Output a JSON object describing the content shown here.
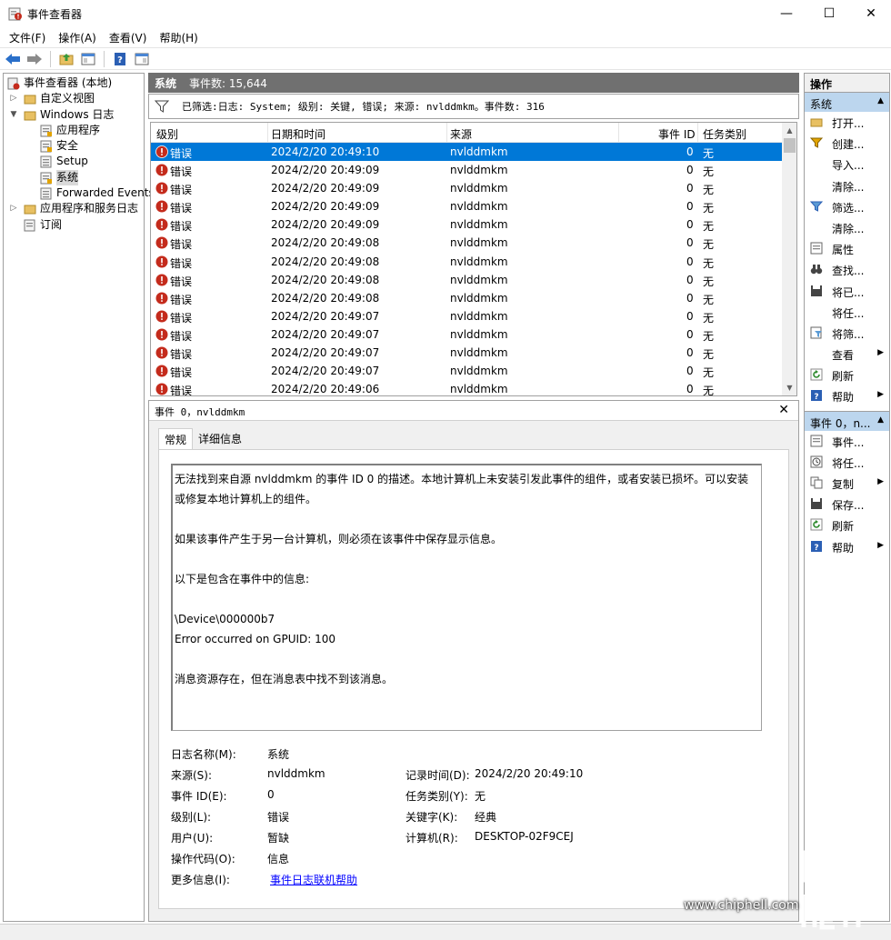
{
  "window": {
    "title": "事件查看器",
    "min": "—",
    "max": "☐",
    "close": "✕"
  },
  "menu": [
    "文件(F)",
    "操作(A)",
    "查看(V)",
    "帮助(H)"
  ],
  "tree": {
    "root": "事件查看器 (本地)",
    "custom_views": "自定义视图",
    "windows_logs": "Windows 日志",
    "app": "应用程序",
    "security": "安全",
    "setup": "Setup",
    "system": "系统",
    "forwarded": "Forwarded Events",
    "app_services": "应用程序和服务日志",
    "subscriptions": "订阅"
  },
  "middle": {
    "log_name": "系统",
    "event_count": "事件数: 15,644",
    "filter_text": "已筛选:日志: System; 级别: 关键, 错误; 来源: nvlddmkm。事件数: 316"
  },
  "grid": {
    "headers": {
      "level": "级别",
      "datetime": "日期和时间",
      "source": "来源",
      "event_id": "事件 ID",
      "task": "任务类别"
    },
    "rows": [
      {
        "level": "错误",
        "datetime": "2024/2/20 20:49:10",
        "source": "nvlddmkm",
        "event_id": "0",
        "task": "无"
      },
      {
        "level": "错误",
        "datetime": "2024/2/20 20:49:09",
        "source": "nvlddmkm",
        "event_id": "0",
        "task": "无"
      },
      {
        "level": "错误",
        "datetime": "2024/2/20 20:49:09",
        "source": "nvlddmkm",
        "event_id": "0",
        "task": "无"
      },
      {
        "level": "错误",
        "datetime": "2024/2/20 20:49:09",
        "source": "nvlddmkm",
        "event_id": "0",
        "task": "无"
      },
      {
        "level": "错误",
        "datetime": "2024/2/20 20:49:09",
        "source": "nvlddmkm",
        "event_id": "0",
        "task": "无"
      },
      {
        "level": "错误",
        "datetime": "2024/2/20 20:49:08",
        "source": "nvlddmkm",
        "event_id": "0",
        "task": "无"
      },
      {
        "level": "错误",
        "datetime": "2024/2/20 20:49:08",
        "source": "nvlddmkm",
        "event_id": "0",
        "task": "无"
      },
      {
        "level": "错误",
        "datetime": "2024/2/20 20:49:08",
        "source": "nvlddmkm",
        "event_id": "0",
        "task": "无"
      },
      {
        "level": "错误",
        "datetime": "2024/2/20 20:49:08",
        "source": "nvlddmkm",
        "event_id": "0",
        "task": "无"
      },
      {
        "level": "错误",
        "datetime": "2024/2/20 20:49:07",
        "source": "nvlddmkm",
        "event_id": "0",
        "task": "无"
      },
      {
        "level": "错误",
        "datetime": "2024/2/20 20:49:07",
        "source": "nvlddmkm",
        "event_id": "0",
        "task": "无"
      },
      {
        "level": "错误",
        "datetime": "2024/2/20 20:49:07",
        "source": "nvlddmkm",
        "event_id": "0",
        "task": "无"
      },
      {
        "level": "错误",
        "datetime": "2024/2/20 20:49:07",
        "source": "nvlddmkm",
        "event_id": "0",
        "task": "无"
      },
      {
        "level": "错误",
        "datetime": "2024/2/20 20:49:06",
        "source": "nvlddmkm",
        "event_id": "0",
        "task": "无"
      }
    ]
  },
  "detail": {
    "title": "事件 0，nvlddmkm",
    "tabs": [
      "常规",
      "详细信息"
    ],
    "description": "无法找到来自源 nvlddmkm 的事件 ID 0 的描述。本地计算机上未安装引发此事件的组件，或者安装已损坏。可以安装或修复本地计算机上的组件。\n\n如果该事件产生于另一台计算机，则必须在该事件中保存显示信息。\n\n以下是包含在事件中的信息:\n\n\\Device\\000000b7\nError occurred on GPUID: 100\n\n消息资源存在，但在消息表中找不到该消息。",
    "props": {
      "log_name_label": "日志名称(M):",
      "log_name": "系统",
      "source_label": "来源(S):",
      "source": "nvlddmkm",
      "logged_label": "记录时间(D):",
      "logged": "2024/2/20 20:49:10",
      "event_id_label": "事件 ID(E):",
      "event_id": "0",
      "task_label": "任务类别(Y):",
      "task": "无",
      "level_label": "级别(L):",
      "level": "错误",
      "keywords_label": "关键字(K):",
      "keywords": "经典",
      "user_label": "用户(U):",
      "user": "暂缺",
      "computer_label": "计算机(R):",
      "computer": "DESKTOP-02F9CEJ",
      "opcode_label": "操作代码(O):",
      "opcode": "信息",
      "more_label": "更多信息(I):",
      "more_link": "事件日志联机帮助"
    }
  },
  "actions": {
    "header": "操作",
    "section1": "系统",
    "items1": [
      "打开...",
      "创建...",
      "导入...",
      "清除...",
      "筛选...",
      "清除...",
      "属性",
      "查找...",
      "将已...",
      "将任...",
      "将筛...",
      "查看",
      "刷新",
      "帮助"
    ],
    "section2": "事件 0，n...",
    "items2": [
      "事件...",
      "将任...",
      "复制",
      "保存...",
      "刷新",
      "帮助"
    ]
  },
  "watermark": "www.chiphell.com",
  "colors": {
    "selection": "#0078d7",
    "header_gray": "#707070",
    "action_section": "#bcd6ee",
    "error_red": "#c42b1c"
  }
}
